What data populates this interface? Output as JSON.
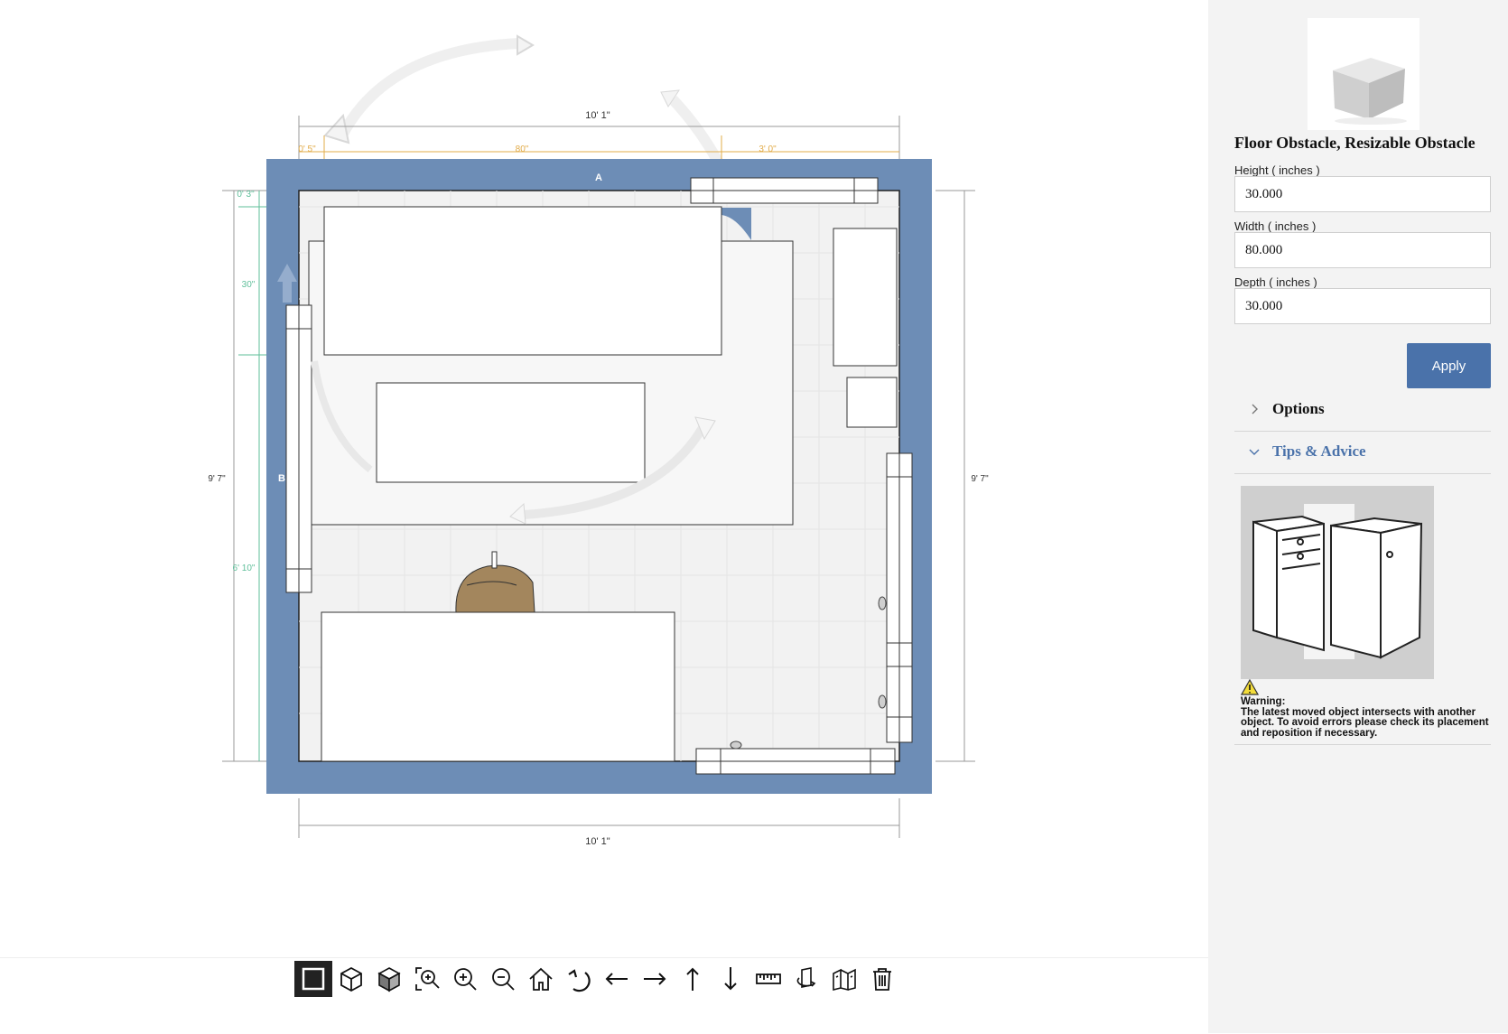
{
  "colors": {
    "wall": "#6d8db6",
    "accent": "#4a72aa",
    "dim_orange": "#e2ac4a",
    "dim_green": "#5fbf9a",
    "chair": "#a3865d"
  },
  "floorplan": {
    "wall_labels": {
      "a": "A",
      "b": "B"
    },
    "dimensions": {
      "top_width": "10' 1\"",
      "bottom_width": "10' 1\"",
      "left_height": "9' 7\"",
      "right_height": "9' 7\"",
      "orange_left": "0' 5\"",
      "orange_mid": "80\"",
      "orange_right": "3' 0\"",
      "green_top": "0' 3\"",
      "green_mid": "30\"",
      "green_bottom": "6' 10\""
    }
  },
  "toolbar": {
    "tools": [
      {
        "name": "2d-view",
        "icon": "square-icon",
        "active": true
      },
      {
        "name": "3d-view",
        "icon": "cube-outline-icon",
        "active": false
      },
      {
        "name": "3d-solid-view",
        "icon": "cube-shaded-icon",
        "active": false
      },
      {
        "name": "zoom-fit",
        "icon": "zoom-fit-icon",
        "active": false
      },
      {
        "name": "zoom-in",
        "icon": "zoom-in-icon",
        "active": false
      },
      {
        "name": "zoom-out",
        "icon": "zoom-out-icon",
        "active": false
      },
      {
        "name": "home",
        "icon": "home-icon",
        "active": false
      },
      {
        "name": "rotate",
        "icon": "rotate-icon",
        "active": false
      },
      {
        "name": "move-left",
        "icon": "arrow-left-icon",
        "active": false
      },
      {
        "name": "move-right",
        "icon": "arrow-right-icon",
        "active": false
      },
      {
        "name": "move-up",
        "icon": "arrow-up-icon",
        "active": false
      },
      {
        "name": "move-down",
        "icon": "arrow-down-icon",
        "active": false
      },
      {
        "name": "measure",
        "icon": "ruler-icon",
        "active": false
      },
      {
        "name": "flip",
        "icon": "flip-icon",
        "active": false
      },
      {
        "name": "walls",
        "icon": "walls-icon",
        "active": false
      },
      {
        "name": "delete",
        "icon": "trash-icon",
        "active": false
      }
    ]
  },
  "panel": {
    "thumbnail_icon": "box-obstacle-icon",
    "title": "Floor Obstacle, Resizable Obstacle",
    "fields": {
      "height": {
        "label": "Height ( inches )",
        "value": "30.000"
      },
      "width": {
        "label": "Width ( inches )",
        "value": "80.000"
      },
      "depth": {
        "label": "Depth ( inches )",
        "value": "30.000"
      }
    },
    "apply_label": "Apply",
    "options_label": "Options",
    "tips_label": "Tips & Advice",
    "tips_image_icon": "corner-cabinets-icon",
    "warning_title": "Warning:",
    "warning_text": "The latest moved object intersects with another object. To avoid errors please check its placement and reposition if necessary."
  }
}
